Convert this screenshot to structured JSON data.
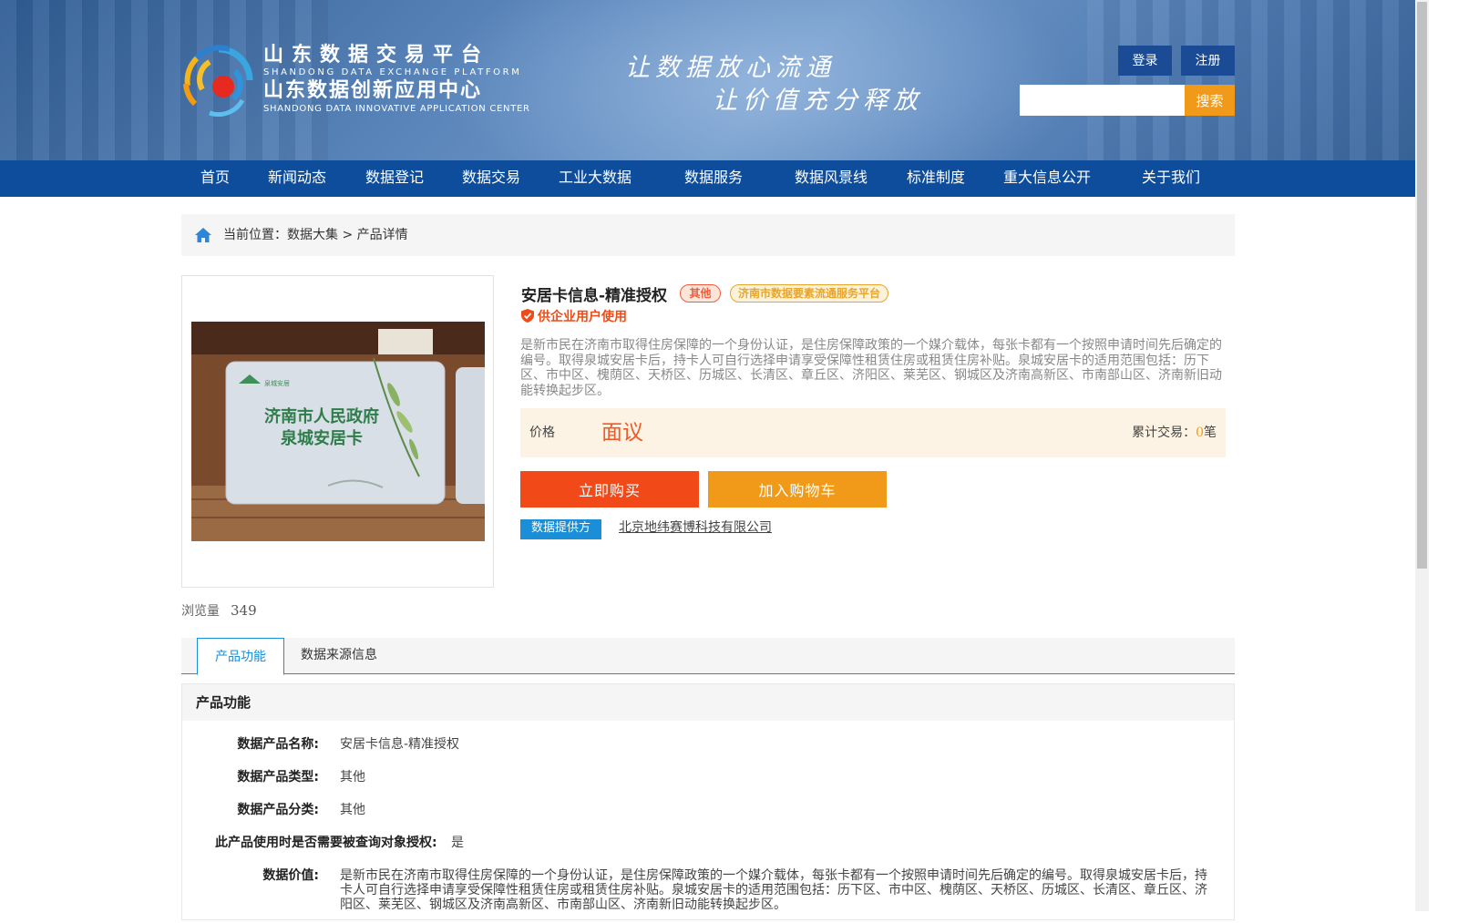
{
  "header": {
    "brand_cn_1": "山东数据交易平台",
    "brand_en_1": "SHANDONG DATA EXCHANGE PLATFORM",
    "brand_cn_2": "山东数据创新应用中心",
    "brand_en_2": "SHANDONG DATA INNOVATIVE APPLICATION CENTER",
    "slogan_1": "让数据放心流通",
    "slogan_2": "让价值充分释放",
    "login_label": "登录",
    "register_label": "注册",
    "search_placeholder": "",
    "search_label": "搜索"
  },
  "nav": {
    "items": [
      "首页",
      "新闻动态",
      "数据登记",
      "数据交易",
      "工业大数据",
      "数据服务",
      "数据风景线",
      "标准制度",
      "重大信息公开",
      "关于我们"
    ]
  },
  "breadcrumb": {
    "text": "当前位置：数据大集 > 产品详情"
  },
  "product": {
    "image_card_text_1": "济南市人民政府",
    "image_card_text_2": "泉城安居卡",
    "image_card_brand": "泉城安居",
    "title": "安居卡信息-精准授权",
    "tag_category": "其他",
    "tag_platform": "济南市数据要素流通服务平台",
    "enterprise_note": "供企业用户使用",
    "description": "是新市民在济南市取得住房保障的一个身份认证，是住房保障政策的一个媒介载体，每张卡都有一个按照申请时间先后确定的编号。取得泉城安居卡后，持卡人可自行选择申请享受保障性租赁住房或租赁住房补贴。泉城安居卡的适用范围包括：历下区、市中区、槐荫区、天桥区、历城区、长清区、章丘区、济阳区、莱芜区、钢城区及济南高新区、市南部山区、济南新旧动能转换起步区。",
    "price_label": "价格",
    "price_value": "面议",
    "trade_label": "累计交易：",
    "trade_count": "0",
    "trade_unit": "笔",
    "buy_label": "立即购买",
    "cart_label": "加入购物车",
    "provider_tag": "数据提供方",
    "provider_name": "北京地纬赛博科技有限公司",
    "views_label": "浏览量",
    "views_count": "349"
  },
  "tabs": {
    "items": [
      "产品功能",
      "数据来源信息"
    ],
    "active": "产品功能"
  },
  "section": {
    "title": "产品功能",
    "rows": [
      {
        "key": "数据产品名称:",
        "value": "安居卡信息-精准授权"
      },
      {
        "key": "数据产品类型:",
        "value": "其他"
      },
      {
        "key": "数据产品分类:",
        "value": "其他"
      },
      {
        "key": "此产品使用时是否需要被查询对象授权:",
        "value": "是"
      },
      {
        "key": "数据价值:",
        "value": "是新市民在济南市取得住房保障的一个身份认证，是住房保障政策的一个媒介载体，每张卡都有一个按照申请时间先后确定的编号。取得泉城安居卡后，持卡人可自行选择申请享受保障性租赁住房或租赁住房补贴。泉城安居卡的适用范围包括：历下区、市中区、槐荫区、天桥区、历城区、长清区、章丘区、济阳区、莱芜区、钢城区及济南高新区、市南部山区、济南新旧动能转换起步区。"
      }
    ]
  },
  "colors": {
    "nav_bg": "#0e4d9c",
    "accent_orange": "#f19a1a",
    "accent_red": "#f14a18",
    "link_blue": "#1a8fd8"
  }
}
